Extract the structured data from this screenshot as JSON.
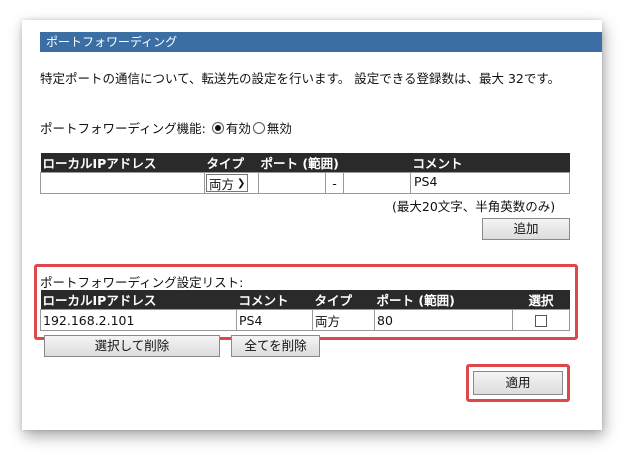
{
  "header": {
    "title": "ポートフォワーディング"
  },
  "description": "特定ポートの通信について、転送先の設定を行います。 設定できる登録数は、最大 32です。",
  "function_row": {
    "label": "ポートフォワーディング機能:",
    "options": [
      "有効",
      "無効"
    ],
    "selected": "有効"
  },
  "add_form": {
    "columns": [
      "ローカルIPアドレス",
      "タイプ",
      "ポート (範囲)",
      "コメント"
    ],
    "ip_value": "",
    "type_value": "両方",
    "port_from": "",
    "port_sep": "-",
    "port_to": "",
    "comment_value": "PS4",
    "note": "(最大20文字、半角英数のみ)",
    "add_button": "追加"
  },
  "list": {
    "title": "ポートフォワーディング設定リスト:",
    "columns": [
      "ローカルIPアドレス",
      "コメント",
      "タイプ",
      "ポート (範囲)",
      "選択"
    ],
    "rows": [
      {
        "ip": "192.168.2.101",
        "comment": "PS4",
        "type": "両方",
        "port": "80"
      }
    ],
    "delete_selected_button": "選択して削除",
    "delete_all_button": "全てを削除"
  },
  "apply_button": "適用",
  "colors": {
    "header_bg": "#3b6ea3",
    "table_header_bg": "#2a2a2a",
    "highlight": "#e0474c"
  }
}
